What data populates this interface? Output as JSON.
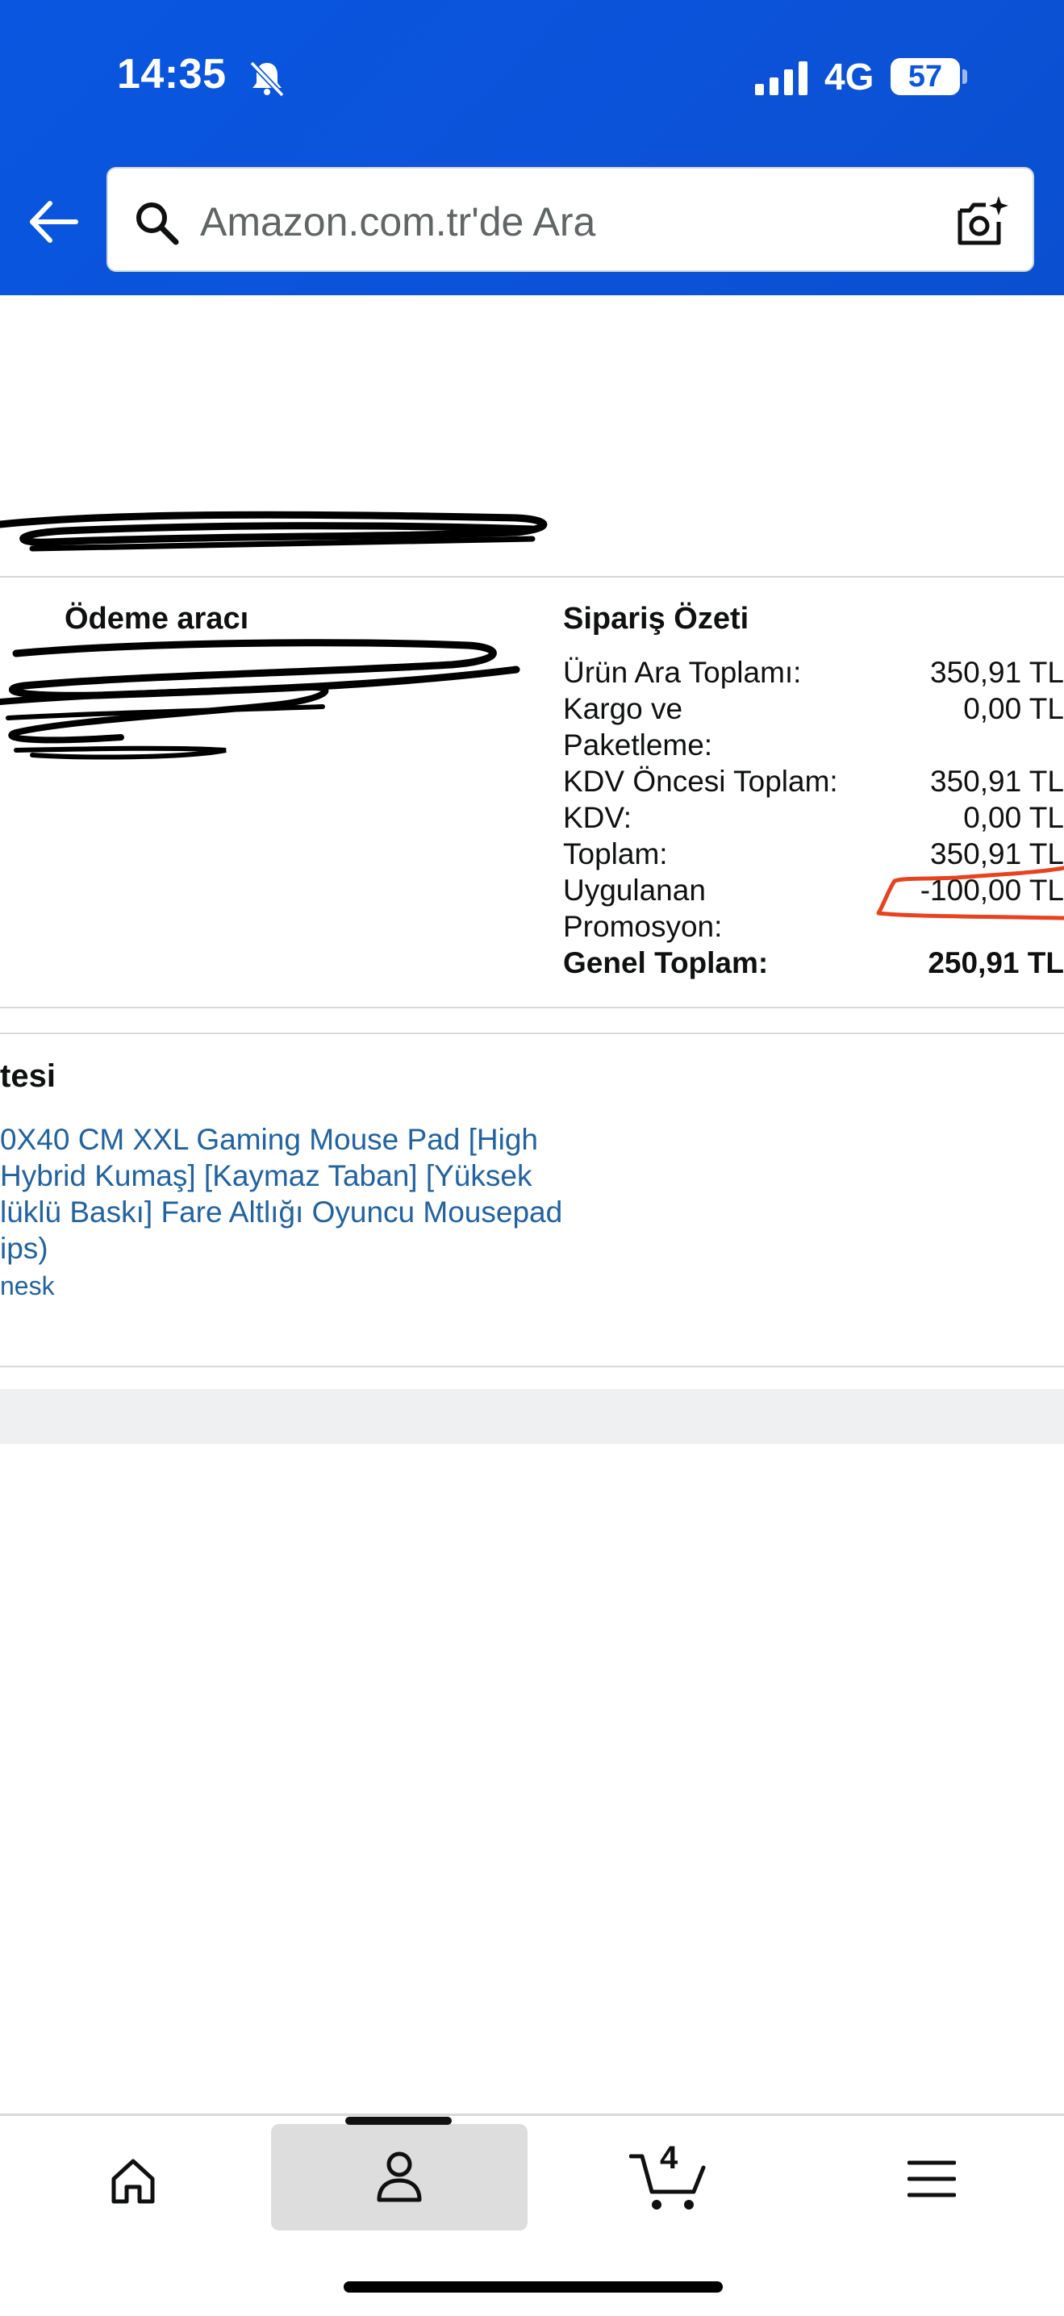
{
  "status_bar": {
    "time": "14:35",
    "network": "4G",
    "battery": "57"
  },
  "search": {
    "placeholder": "Amazon.com.tr'de Ara"
  },
  "payment": {
    "title": "Ödeme aracı"
  },
  "order_summary": {
    "title": "Sipariş Özeti",
    "rows": [
      {
        "label": "Ürün Ara Toplamı:",
        "value": "350,91 TL"
      },
      {
        "label": "Kargo ve",
        "value": "0,00 TL"
      },
      {
        "label": "Paketleme:",
        "value": ""
      },
      {
        "label": "KDV Öncesi Toplam:",
        "value": "350,91 TL"
      },
      {
        "label": "KDV:",
        "value": "0,00 TL"
      },
      {
        "label": "Toplam:",
        "value": "350,91 TL"
      },
      {
        "label": "Uygulanan",
        "value": "-100,00 TL"
      },
      {
        "label": "Promosyon:",
        "value": ""
      }
    ],
    "grand_total_label": "Genel Toplam:",
    "grand_total_value": "250,91 TL"
  },
  "shipment": {
    "title": "tesi",
    "product_lines": [
      "0X40 CM XXL Gaming Mouse Pad [High",
      "Hybrid Kumaş] [Kaymaz Taban] [Yüksek",
      "lüklü Baskı] Fare Altlığı Oyuncu Mousepad",
      "ips)"
    ],
    "product_sub": "nesk"
  },
  "bottom_nav": {
    "cart_count": "4",
    "items": [
      "home-icon",
      "account-icon",
      "cart-icon",
      "menu-icon"
    ]
  },
  "colors": {
    "header_blue": "#0a56e0",
    "link_blue": "#2162a1",
    "annotation_red": "#e8421f"
  }
}
